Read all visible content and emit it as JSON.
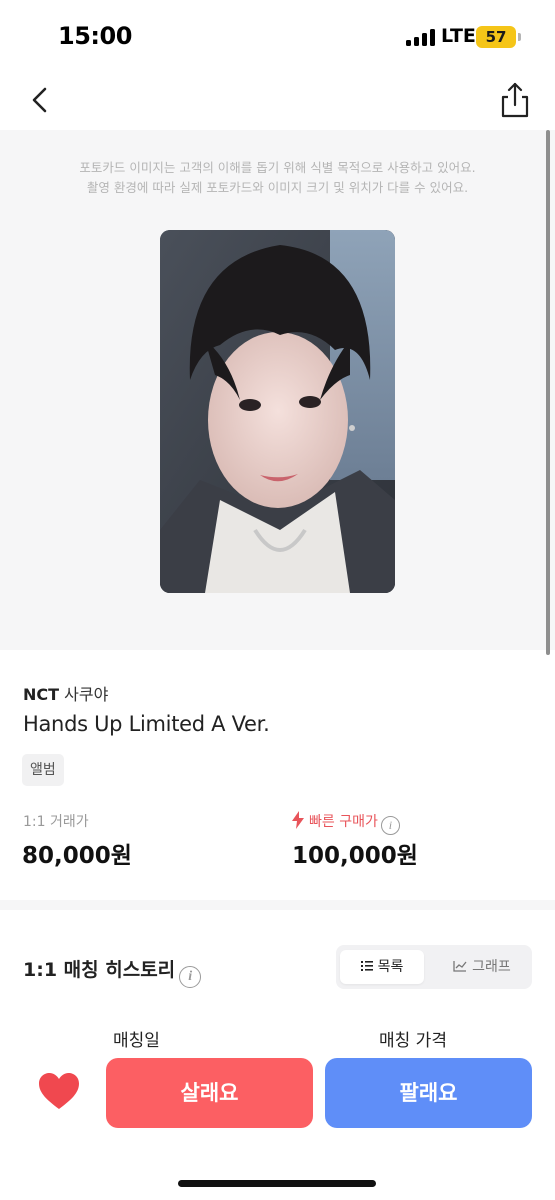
{
  "status_bar": {
    "time": "15:00",
    "network": "LTE",
    "battery": "57",
    "signal_bars": 4,
    "battery_color": "#f5c518"
  },
  "nav": {
    "back_icon": "chevron-left-icon",
    "share_icon": "share-icon"
  },
  "image_notice": {
    "line1": "포토카드 이미지는 고객의 이해를 돕기 위해 식별 목적으로 사용하고 있어요.",
    "line2": "촬영 환경에 따라 실제 포토카드와 이미지 크기 및 위치가 다를 수 있어요."
  },
  "product": {
    "group": "NCT",
    "member": "사쿠야",
    "title": "Hands Up Limited A Ver.",
    "tag": "앨범"
  },
  "prices": {
    "one_to_one_label": "1:1 거래가",
    "one_to_one_price": "80,000원",
    "fast_buy_label": "빠른 구매가",
    "fast_buy_price": "100,000원",
    "fast_color": "#e8545a"
  },
  "history": {
    "title": "1:1 매칭 히스토리",
    "tabs": {
      "list": "목록",
      "graph": "그래프"
    },
    "selected_tab": "목록",
    "columns": {
      "date": "매칭일",
      "price": "매칭 가격"
    }
  },
  "actions": {
    "buy": "살래요",
    "sell": "팔래요",
    "buy_color": "#fc5f63",
    "sell_color": "#5f8ef8",
    "heart_color": "#f0484f"
  }
}
